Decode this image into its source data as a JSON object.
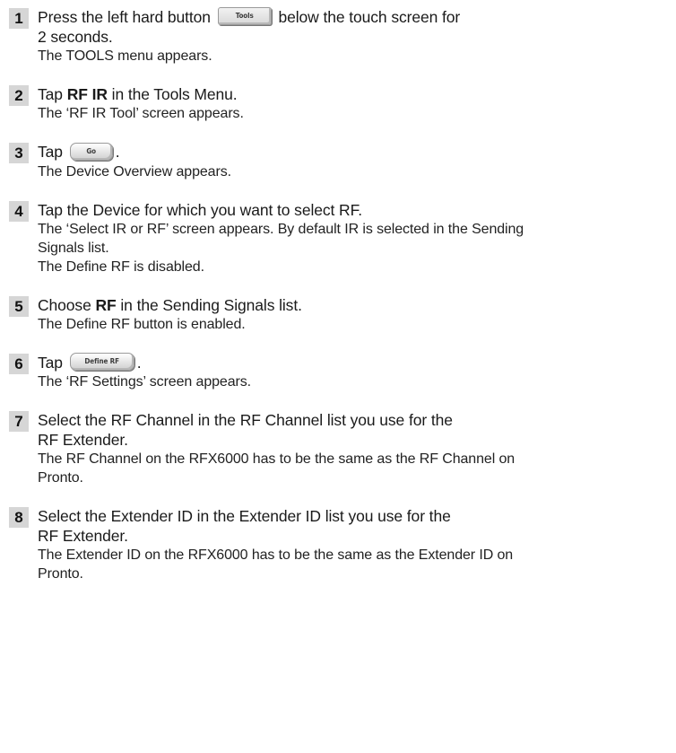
{
  "steps": [
    {
      "num": "1",
      "instr_a": "Press the left hard button",
      "button": "Tools",
      "instr_b": "below the touch screen for",
      "instr_c": "2 seconds.",
      "result": "The TOOLS menu appears."
    },
    {
      "num": "2",
      "instr_a": "Tap",
      "bold": "RF IR",
      "instr_b": "in the Tools Menu.",
      "result": "The ‘RF IR Tool’ screen appears."
    },
    {
      "num": "3",
      "instr_a": "Tap",
      "button": "Go",
      "instr_b": ".",
      "result": "The Device Overview appears."
    },
    {
      "num": "4",
      "instr": "Tap the Device for which you want to select RF.",
      "result_a": "The ‘Select IR or RF’ screen appears. By default IR is selected in the Sending",
      "result_b": "Signals list.",
      "result_c": "The Define RF is disabled."
    },
    {
      "num": "5",
      "instr_a": "Choose",
      "bold": "RF",
      "instr_b": "in the Sending Signals list.",
      "result": "The Define RF button is enabled."
    },
    {
      "num": "6",
      "instr_a": "Tap",
      "button": "Define RF",
      "instr_b": ".",
      "result": "The ‘RF Settings’ screen appears."
    },
    {
      "num": "7",
      "instr_a": "Select the RF Channel in the RF Channel list you use for the",
      "instr_b": "RF Extender.",
      "result_a": "The RF Channel on the RFX6000 has to be the same as the RF Channel on",
      "result_b": "Pronto."
    },
    {
      "num": "8",
      "instr_a": "Select the Extender ID in the Extender ID list you use for the",
      "instr_b": "RF Extender.",
      "result_a": "The Extender ID on the RFX6000 has to be the same as the Extender ID on",
      "result_b": "Pronto."
    }
  ]
}
